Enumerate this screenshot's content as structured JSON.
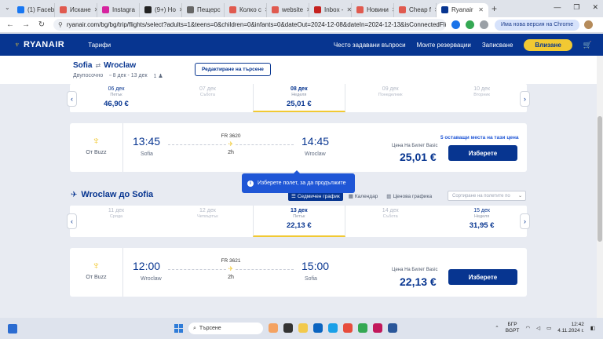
{
  "browser": {
    "tabs": [
      {
        "label": "(1) Faceb",
        "color": "#1877f2"
      },
      {
        "label": "Искане",
        "color": "#e05a4f"
      },
      {
        "label": "Instagra",
        "color": "#d6249f"
      },
      {
        "label": "(9+) Ho",
        "color": "#222222"
      },
      {
        "label": "Пещерс",
        "color": "#666666"
      },
      {
        "label": "Колко с",
        "color": "#e05a4f"
      },
      {
        "label": "websitе",
        "color": "#e05a4f"
      },
      {
        "label": "Inbox -",
        "color": "#c5221f"
      },
      {
        "label": "Новини",
        "color": "#e05a4f"
      },
      {
        "label": "Cheap f",
        "color": "#e05a4f"
      }
    ],
    "active_tab": "Ryanair",
    "new_tab": "+",
    "url": "ryanair.com/bg/bg/trip/flights/select?adults=1&teens=0&children=0&infants=0&dateOut=2024-12-08&dateIn=2024-12-13&isConnectedFlight=f...",
    "update_label": "Има нова версия на Chrome",
    "window_controls": [
      "—",
      "❐",
      "✕"
    ]
  },
  "header": {
    "logo": "RYANAIR",
    "tariffs": "Тарифи",
    "faq": "Често задавани въпроси",
    "my_bookings": "Моите резервации",
    "signup": "Записване",
    "login": "Влизане"
  },
  "summary": {
    "from": "Sofia",
    "to": "Wroclaw",
    "trip_type": "Двупосочно",
    "dates": "8 дек - 13 дек",
    "passengers": "1",
    "edit_label": "Редактиране на търсене"
  },
  "outbound_dates": [
    {
      "date": "06 дек",
      "weekday": "Петък",
      "price": "46,90 €",
      "state": "normal"
    },
    {
      "date": "07 дек",
      "weekday": "Събота",
      "price": "",
      "state": "muted"
    },
    {
      "date": "08 дек",
      "weekday": "Неделя",
      "price": "25,01 €",
      "state": "selected"
    },
    {
      "date": "09 дек",
      "weekday": "Понеделник",
      "price": "",
      "state": "muted"
    },
    {
      "date": "10 дек",
      "weekday": "Вторник",
      "price": "",
      "state": "muted"
    }
  ],
  "outbound_flight": {
    "operator": "От Buzz",
    "dep_time": "13:45",
    "dep_city": "Sofia",
    "arr_time": "14:45",
    "arr_city": "Wroclaw",
    "flight_no": "FR 3620",
    "duration": "2h",
    "price_label": "Цена На Билет Basic",
    "price": "25,01 €",
    "seats_left": "5 оставащи места на тази цена",
    "select_label": "Изберете"
  },
  "tooltip": {
    "text": "Изберете полет, за да продължите"
  },
  "return_section": {
    "title": "Wroclaw до Sofia",
    "view_weekly": "Седмичен график",
    "view_calendar": "Календар",
    "view_price": "Ценова графика",
    "sort_placeholder": "Сортиране на полетите по"
  },
  "return_dates": [
    {
      "date": "11 дек",
      "weekday": "Сряда",
      "price": "",
      "state": "muted"
    },
    {
      "date": "12 дек",
      "weekday": "Четвъртък",
      "price": "",
      "state": "muted"
    },
    {
      "date": "13 дек",
      "weekday": "Петък",
      "price": "22,13 €",
      "state": "selected"
    },
    {
      "date": "14 дек",
      "weekday": "Събота",
      "price": "",
      "state": "muted"
    },
    {
      "date": "15 дек",
      "weekday": "Неделя",
      "price": "31,95 €",
      "state": "normal"
    }
  ],
  "return_flight": {
    "operator": "От Buzz",
    "dep_time": "12:00",
    "dep_city": "Wroclaw",
    "arr_time": "15:00",
    "arr_city": "Sofia",
    "flight_no": "FR 3621",
    "duration": "2h",
    "price_label": "Цена На Билет Basic",
    "price": "22,13 €",
    "select_label": "Изберете"
  },
  "taskbar": {
    "search_placeholder": "Търсене",
    "lang": "БГР",
    "lang2": "BGPT",
    "time": "12:42",
    "date": "4.11.2024 г."
  }
}
